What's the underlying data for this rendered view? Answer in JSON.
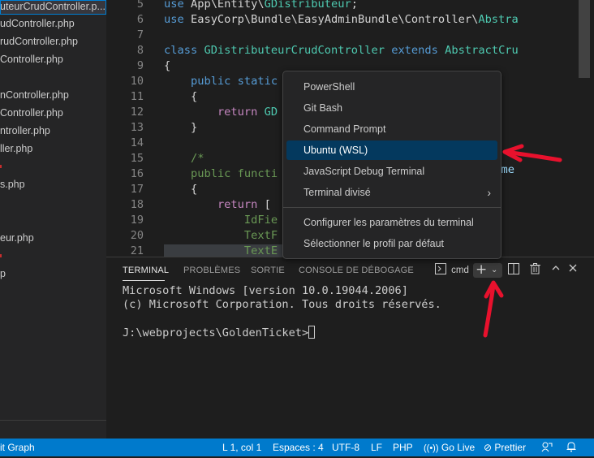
{
  "sidebar": {
    "files": [
      {
        "label": "uteurCrudController.p...",
        "active": true
      },
      {
        "label": "udController.php"
      },
      {
        "label": "rudController.php"
      },
      {
        "label": "Controller.php"
      },
      {
        "label": "nController.php"
      },
      {
        "label": "Controller.php"
      },
      {
        "label": "ntroller.php"
      },
      {
        "label": "ller.php"
      },
      {
        "label": "s.php"
      },
      {
        "label": "eur.php"
      },
      {
        "label": "p"
      }
    ]
  },
  "editor": {
    "lines": [
      {
        "n": "5",
        "html": "<span class='kw'>use</span> App\\Entity\\<span class='cls'>GDistributeur</span>;"
      },
      {
        "n": "6",
        "html": "<span class='kw'>use</span> EasyCorp\\Bundle\\EasyAdminBundle\\Controller\\<span class='cls'>Abstra</span>"
      },
      {
        "n": "7",
        "html": ""
      },
      {
        "n": "8",
        "html": "<span class='kw'>class</span> <span class='cls'>GDistributeurCrudController</span> <span class='kw'>extends</span> <span class='cls'>AbstractCru</span>"
      },
      {
        "n": "9",
        "html": "{"
      },
      {
        "n": "10",
        "html": "    <span class='kw'>public</span> <span class='kw'>static</span>"
      },
      {
        "n": "11",
        "html": "    {"
      },
      {
        "n": "12",
        "html": "        <span class='ctl'>return</span> <span class='cls'>GD</span>"
      },
      {
        "n": "13",
        "html": "    }"
      },
      {
        "n": "14",
        "html": ""
      },
      {
        "n": "15",
        "html": "    <span class='cmt'>/*</span>"
      },
      {
        "n": "16",
        "html": "    <span class='cmt'>public functi</span>"
      },
      {
        "n": "17",
        "html": "    {"
      },
      {
        "n": "18",
        "html": "        <span class='ctl'>return</span> ["
      },
      {
        "n": "19",
        "html": "            <span class='cmt'>IdFie</span>"
      },
      {
        "n": "20",
        "html": "            <span class='cmt'>TextF</span>"
      },
      {
        "n": "21",
        "html": "            <span class='cmt'>TextE</span>"
      }
    ],
    "overflow_right": [
      {
        "line": "10",
        "text": "ng"
      },
      {
        "line": "16",
        "text": "Name"
      }
    ]
  },
  "panel": {
    "tabs": [
      "TERMINAL",
      "PROBLÈMES",
      "SORTIE",
      "CONSOLE DE DÉBOGAGE"
    ],
    "terminal_name": "cmd",
    "terminal_lines": [
      "Microsoft Windows [version 10.0.19044.2006]",
      "(c) Microsoft Corporation. Tous droits réservés.",
      "",
      "J:\\webprojects\\GoldenTicket>"
    ]
  },
  "menu": {
    "items": [
      "PowerShell",
      "Git Bash",
      "Command Prompt",
      "Ubuntu (WSL)",
      "JavaScript Debug Terminal",
      "Terminal divisé"
    ],
    "highlighted": "Ubuntu (WSL)",
    "bottom_items": [
      "Configurer les paramètres du terminal",
      "Sélectionner le profil par défaut"
    ]
  },
  "statusbar": {
    "left": "it Graph",
    "position": "L 1, col 1",
    "spaces": "Espaces : 4",
    "encoding": "UTF-8",
    "eol": "LF",
    "language": "PHP",
    "golive": "Go Live",
    "prettier": "Prettier"
  },
  "colors": {
    "accent": "#007acc",
    "menu_highlight": "#04395e",
    "annotation": "#e8112d"
  }
}
